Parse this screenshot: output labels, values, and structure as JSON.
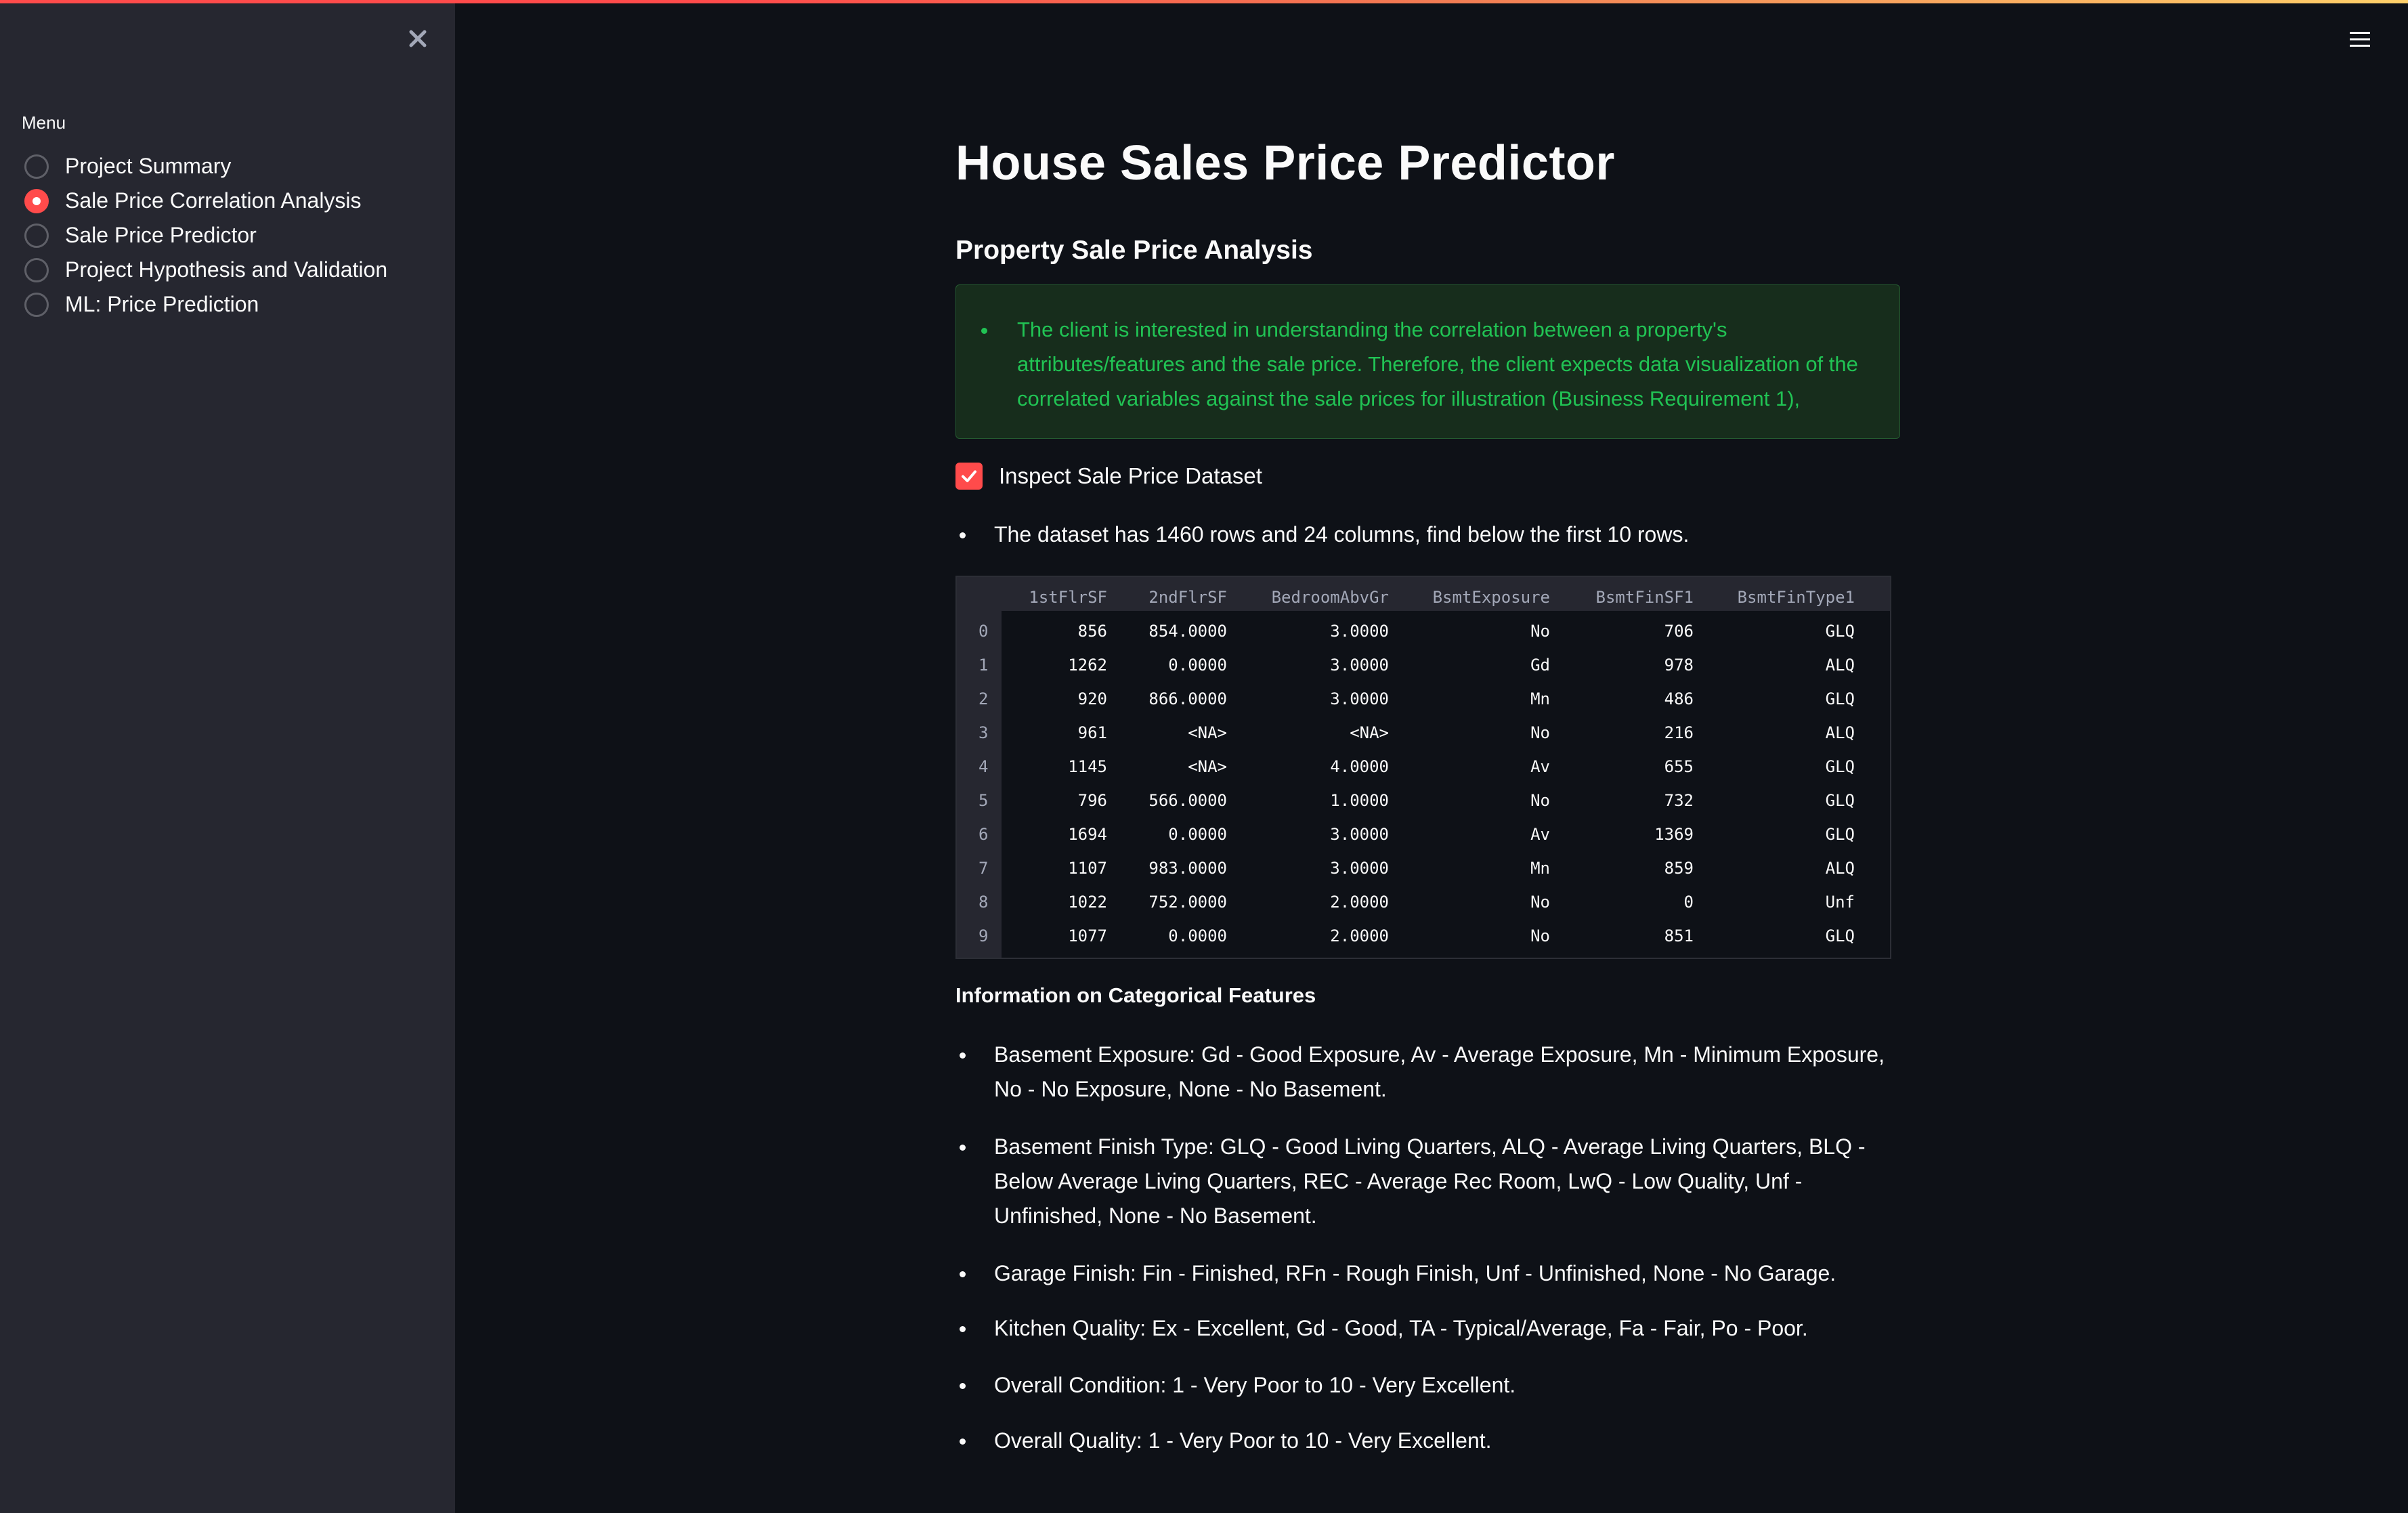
{
  "app": {
    "accent_color": "#ff4b4b",
    "background_color": "#0e1117",
    "sidebar_color": "#262730",
    "success_text_color": "#21c354"
  },
  "sidebar": {
    "close_icon": "close-icon",
    "menu_label": "Menu",
    "items": [
      {
        "label": "Project Summary",
        "selected": false
      },
      {
        "label": "Sale Price Correlation Analysis",
        "selected": true
      },
      {
        "label": "Sale Price Predictor",
        "selected": false
      },
      {
        "label": "Project Hypothesis and Validation",
        "selected": false
      },
      {
        "label": "ML: Price Prediction",
        "selected": false
      }
    ]
  },
  "header": {
    "menu_icon": "hamburger-icon"
  },
  "main": {
    "title": "House Sales Price Predictor",
    "subtitle": "Property Sale Price Analysis",
    "success_message": "The client is interested in understanding the correlation between a property's attributes/features and the sale price. Therefore, the client expects data visualization of the correlated variables against the sale prices for illustration (Business Requirement 1),",
    "checkbox": {
      "label": "Inspect Sale Price Dataset",
      "checked": true
    },
    "dataset_note": "The dataset has 1460 rows and 24 columns, find below the first 10 rows.",
    "table": {
      "columns": [
        "1stFlrSF",
        "2ndFlrSF",
        "BedroomAbvGr",
        "BsmtExposure",
        "BsmtFinSF1",
        "BsmtFinType1"
      ],
      "rows": [
        {
          "index": "0",
          "cells": [
            "856",
            "854.0000",
            "3.0000",
            "No",
            "706",
            "GLQ"
          ]
        },
        {
          "index": "1",
          "cells": [
            "1262",
            "0.0000",
            "3.0000",
            "Gd",
            "978",
            "ALQ"
          ]
        },
        {
          "index": "2",
          "cells": [
            "920",
            "866.0000",
            "3.0000",
            "Mn",
            "486",
            "GLQ"
          ]
        },
        {
          "index": "3",
          "cells": [
            "961",
            "<NA>",
            "<NA>",
            "No",
            "216",
            "ALQ"
          ]
        },
        {
          "index": "4",
          "cells": [
            "1145",
            "<NA>",
            "4.0000",
            "Av",
            "655",
            "GLQ"
          ]
        },
        {
          "index": "5",
          "cells": [
            "796",
            "566.0000",
            "1.0000",
            "No",
            "732",
            "GLQ"
          ]
        },
        {
          "index": "6",
          "cells": [
            "1694",
            "0.0000",
            "3.0000",
            "Av",
            "1369",
            "GLQ"
          ]
        },
        {
          "index": "7",
          "cells": [
            "1107",
            "983.0000",
            "3.0000",
            "Mn",
            "859",
            "ALQ"
          ]
        },
        {
          "index": "8",
          "cells": [
            "1022",
            "752.0000",
            "2.0000",
            "No",
            "0",
            "Unf"
          ]
        },
        {
          "index": "9",
          "cells": [
            "1077",
            "0.0000",
            "2.0000",
            "No",
            "851",
            "GLQ"
          ]
        }
      ]
    },
    "info_heading": "Information on Categorical Features",
    "info_items": [
      "Basement Exposure: Gd - Good Exposure, Av - Average Exposure, Mn - Minimum Exposure, No - No Exposure, None - No Basement.",
      "Basement Finish Type: GLQ - Good Living Quarters, ALQ - Average Living Quarters, BLQ - Below Average Living Quarters, REC - Average Rec Room, LwQ - Low Quality, Unf - Unfinished, None - No Basement.",
      "Garage Finish: Fin - Finished, RFn - Rough Finish, Unf - Unfinished, None - No Garage.",
      "Kitchen Quality: Ex - Excellent, Gd - Good, TA - Typical/Average, Fa - Fair, Po - Poor.",
      "Overall Condition: 1 - Very Poor to 10 - Very Excellent.",
      "Overall Quality: 1 - Very Poor to 10 - Very Excellent."
    ]
  }
}
